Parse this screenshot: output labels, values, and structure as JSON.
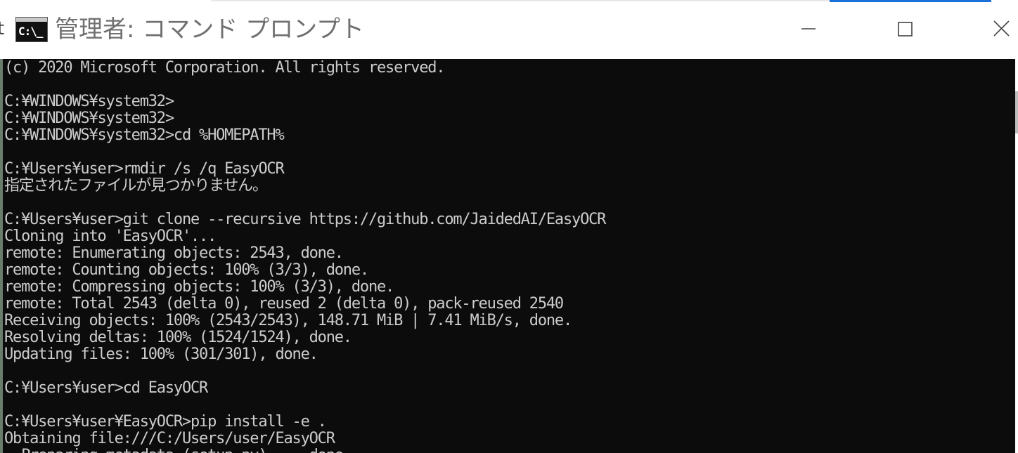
{
  "window": {
    "title": "管理者: コマンド プロンプト",
    "icon_label": "C:\\_",
    "left_glyph": "t"
  },
  "controls": {
    "minimize": "minimize-icon",
    "maximize": "maximize-icon",
    "close": "close-icon"
  },
  "colors": {
    "console_bg": "#0c0c0c",
    "console_text": "#cccccc",
    "accent": "#1a6fd8"
  },
  "console": {
    "lines": [
      "(c) 2020 Microsoft Corporation. All rights reserved.",
      "",
      "C:¥WINDOWS¥system32>",
      "C:¥WINDOWS¥system32>",
      "C:¥WINDOWS¥system32>cd %HOMEPATH%",
      "",
      "C:¥Users¥user>rmdir /s /q EasyOCR",
      "指定されたファイルが見つかりません。",
      "",
      "C:¥Users¥user>git clone --recursive https://github.com/JaidedAI/EasyOCR",
      "Cloning into 'EasyOCR'...",
      "remote: Enumerating objects: 2543, done.",
      "remote: Counting objects: 100% (3/3), done.",
      "remote: Compressing objects: 100% (3/3), done.",
      "remote: Total 2543 (delta 0), reused 2 (delta 0), pack-reused 2540",
      "Receiving objects: 100% (2543/2543), 148.71 MiB | 7.41 MiB/s, done.",
      "Resolving deltas: 100% (1524/1524), done.",
      "Updating files: 100% (301/301), done.",
      "",
      "C:¥Users¥user>cd EasyOCR",
      "",
      "C:¥Users¥user¥EasyOCR>pip install -e .",
      "Obtaining file:///C:/Users/user/EasyOCR",
      "  Preparing metadata (setup.py) ... done"
    ]
  }
}
